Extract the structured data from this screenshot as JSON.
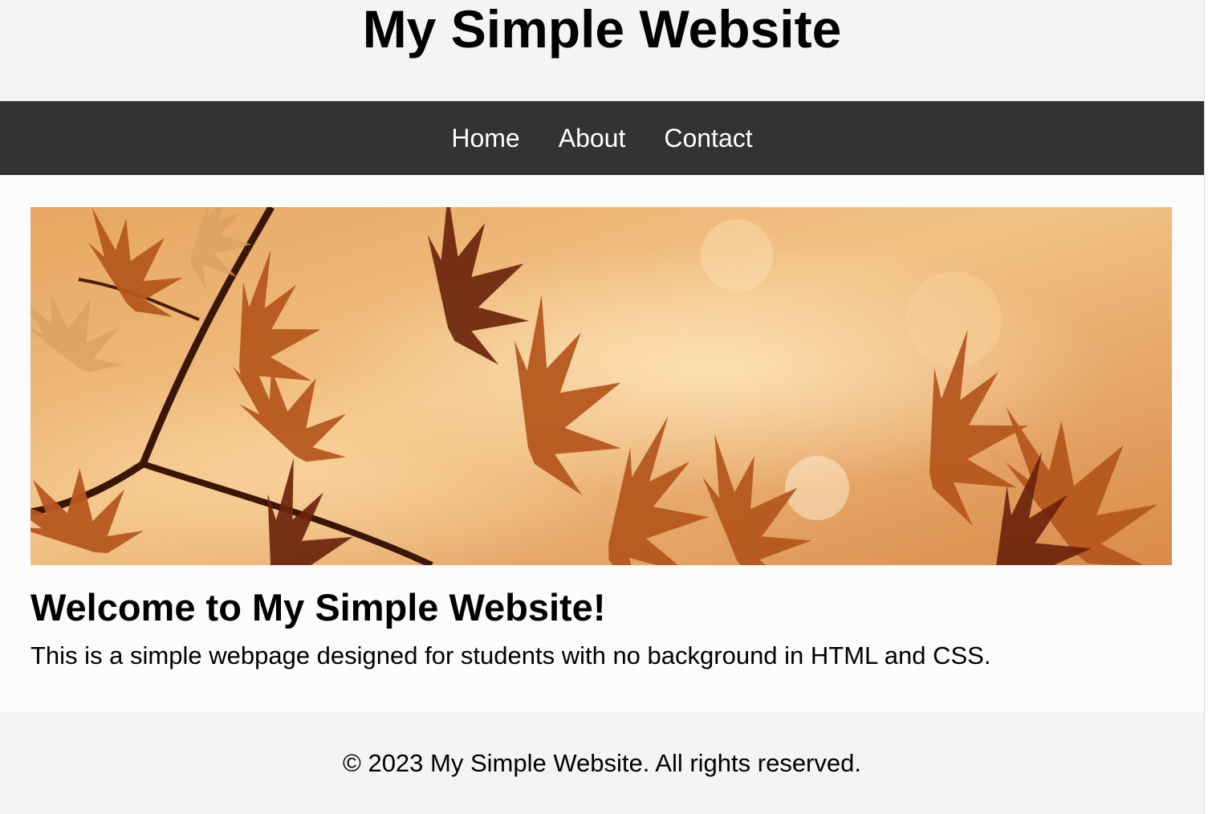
{
  "header": {
    "title": "My Simple Website"
  },
  "nav": {
    "items": [
      {
        "label": "Home"
      },
      {
        "label": "About"
      },
      {
        "label": "Contact"
      }
    ]
  },
  "main": {
    "banner_image": "autumn-maple-leaves",
    "heading": "Welcome to My Simple Website!",
    "paragraph": "This is a simple webpage designed for students with no background in HTML and CSS."
  },
  "footer": {
    "copyright": "© 2023 My Simple Website. All rights reserved."
  },
  "colors": {
    "nav_background": "#333333",
    "nav_text": "#ffffff",
    "header_background": "#f4f4f4",
    "main_background": "#fcfcfc"
  }
}
